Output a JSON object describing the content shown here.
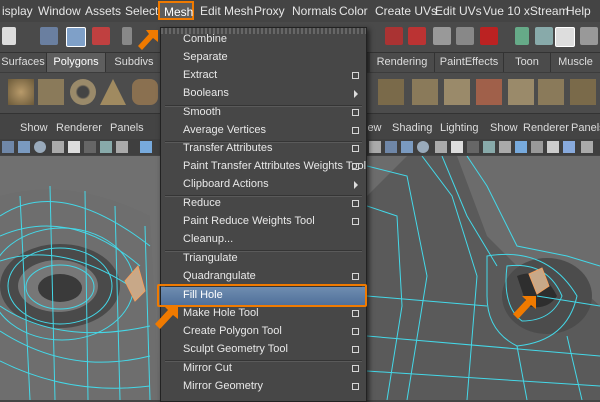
{
  "menubar": {
    "items": [
      "isplay",
      "Window",
      "Assets",
      "Select",
      "Mesh",
      "Edit Mesh",
      "Proxy",
      "Normals",
      "Color",
      "Create UVs",
      "Edit UVs",
      "Vue 10 xStream",
      "Help"
    ]
  },
  "shelf_tabs": [
    "Surfaces",
    "Polygons",
    "Subdivs",
    "Rendering",
    "PaintEffects",
    "Toon",
    "Muscle"
  ],
  "left_panel_menu": [
    "Show",
    "Renderer",
    "Panels"
  ],
  "right_panel_menu": [
    "iew",
    "Shading",
    "Lighting",
    "Show",
    "Renderer",
    "Panels"
  ],
  "mesh_menu": {
    "items": [
      {
        "label": "Combine",
        "option": false,
        "submenu": false
      },
      {
        "label": "Separate",
        "option": false,
        "submenu": false
      },
      {
        "label": "Extract",
        "option": true,
        "submenu": false
      },
      {
        "label": "Booleans",
        "option": false,
        "submenu": true
      },
      {
        "label": "Smooth",
        "option": true,
        "submenu": false
      },
      {
        "label": "Average Vertices",
        "option": true,
        "submenu": false
      },
      {
        "label": "Transfer Attributes",
        "option": true,
        "submenu": false
      },
      {
        "label": "Paint Transfer Attributes Weights Tool",
        "option": true,
        "submenu": false
      },
      {
        "label": "Clipboard Actions",
        "option": false,
        "submenu": true
      },
      {
        "label": "Reduce",
        "option": true,
        "submenu": false
      },
      {
        "label": "Paint Reduce Weights Tool",
        "option": true,
        "submenu": false
      },
      {
        "label": "Cleanup...",
        "option": false,
        "submenu": false
      },
      {
        "label": "Triangulate",
        "option": false,
        "submenu": false
      },
      {
        "label": "Quadrangulate",
        "option": true,
        "submenu": false
      },
      {
        "label": "Fill Hole",
        "option": false,
        "submenu": false,
        "highlighted": true
      },
      {
        "label": "Make Hole Tool",
        "option": true,
        "submenu": false
      },
      {
        "label": "Create Polygon Tool",
        "option": true,
        "submenu": false
      },
      {
        "label": "Sculpt Geometry Tool",
        "option": true,
        "submenu": false
      },
      {
        "label": "Mirror Cut",
        "option": true,
        "submenu": false
      },
      {
        "label": "Mirror Geometry",
        "option": true,
        "submenu": false
      }
    ]
  },
  "colors": {
    "highlight_outline": "#f07a00",
    "menu_highlight": "#5f7fa8",
    "wireframe": "#44d8e8"
  }
}
